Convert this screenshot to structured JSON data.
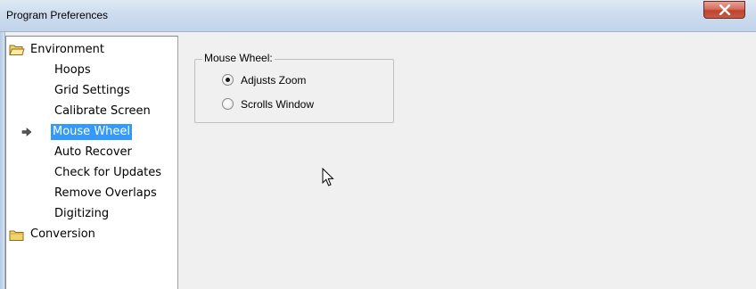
{
  "window": {
    "title": "Program Preferences"
  },
  "tree": {
    "items": [
      {
        "label": "Environment",
        "icon": "folder-open-icon"
      },
      {
        "label": "Hoops"
      },
      {
        "label": "Grid Settings"
      },
      {
        "label": "Calibrate Screen"
      },
      {
        "label": "Mouse Wheel",
        "selected": true,
        "icon": "arrow-right-icon"
      },
      {
        "label": "Auto Recover"
      },
      {
        "label": "Check for Updates"
      },
      {
        "label": "Remove Overlaps"
      },
      {
        "label": "Digitizing"
      },
      {
        "label": "Conversion",
        "icon": "folder-closed-icon"
      }
    ]
  },
  "mouse_wheel": {
    "group_label": "Mouse Wheel:",
    "options": [
      {
        "label": "Adjusts Zoom",
        "checked": true
      },
      {
        "label": "Scrolls Window",
        "checked": false
      }
    ]
  },
  "colors": {
    "selection": "#3399ff",
    "folder": "#f4d36b",
    "close_button": "#c1422d"
  }
}
